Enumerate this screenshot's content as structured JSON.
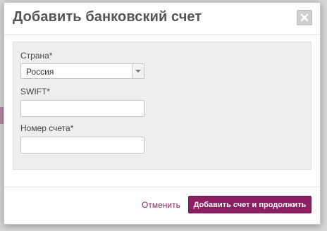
{
  "dialog": {
    "title": "Добавить банковский счет"
  },
  "form": {
    "country": {
      "label": "Страна*",
      "selected": "Россия"
    },
    "swift": {
      "label": "SWIFT*",
      "value": "",
      "placeholder": ""
    },
    "account_number": {
      "label": "Номер счета*",
      "value": "",
      "placeholder": ""
    }
  },
  "footer": {
    "cancel_label": "Отменить",
    "submit_label": "Добавить счет и продолжить"
  },
  "colors": {
    "accent": "#8b1f62",
    "link": "#8b2d66",
    "panel_bg": "#eeeeee"
  }
}
